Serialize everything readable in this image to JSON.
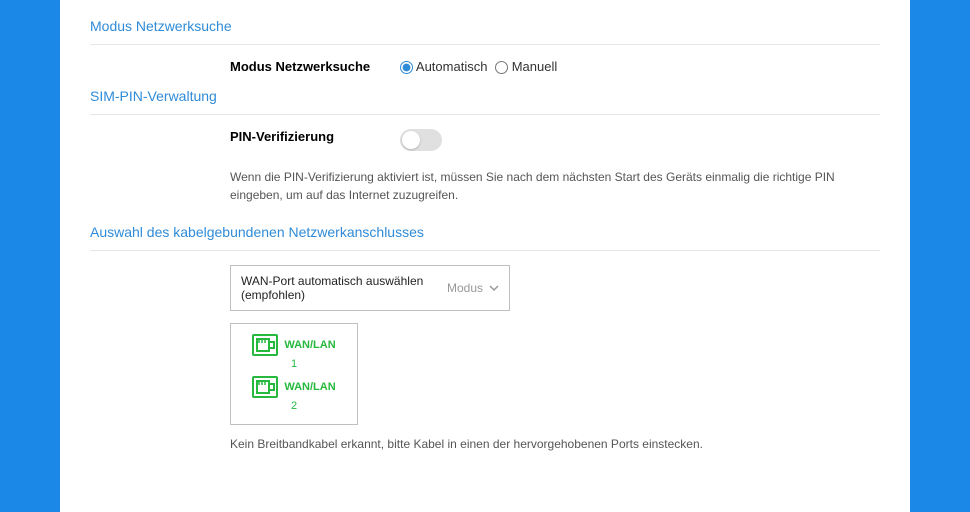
{
  "sections": {
    "network_search": {
      "title": "Modus Netzwerksuche",
      "field_label": "Modus Netzwerksuche",
      "options": {
        "auto": "Automatisch",
        "manual": "Manuell"
      },
      "selected": "auto"
    },
    "sim_pin": {
      "title": "SIM-PIN-Verwaltung",
      "field_label": "PIN-Verifizierung",
      "enabled": false,
      "hint": "Wenn die PIN-Verifizierung aktiviert ist, müssen Sie nach dem nächsten Start des Geräts einmalig die richtige PIN eingeben, um auf das Internet zuzugreifen."
    },
    "wired_port": {
      "title": "Auswahl des kabelgebundenen Netzwerkanschlusses",
      "select_label": "WAN-Port automatisch auswählen (empfohlen)",
      "mode_label": "Modus",
      "ports": [
        {
          "label": "WAN/LAN",
          "num": "1"
        },
        {
          "label": "WAN/LAN",
          "num": "2"
        }
      ],
      "no_cable": "Kein Breitbandkabel erkannt, bitte Kabel in einen der hervorgehobenen Ports einstecken."
    }
  },
  "colors": {
    "accent": "#2f8bd8",
    "port_green": "#27b83e"
  }
}
